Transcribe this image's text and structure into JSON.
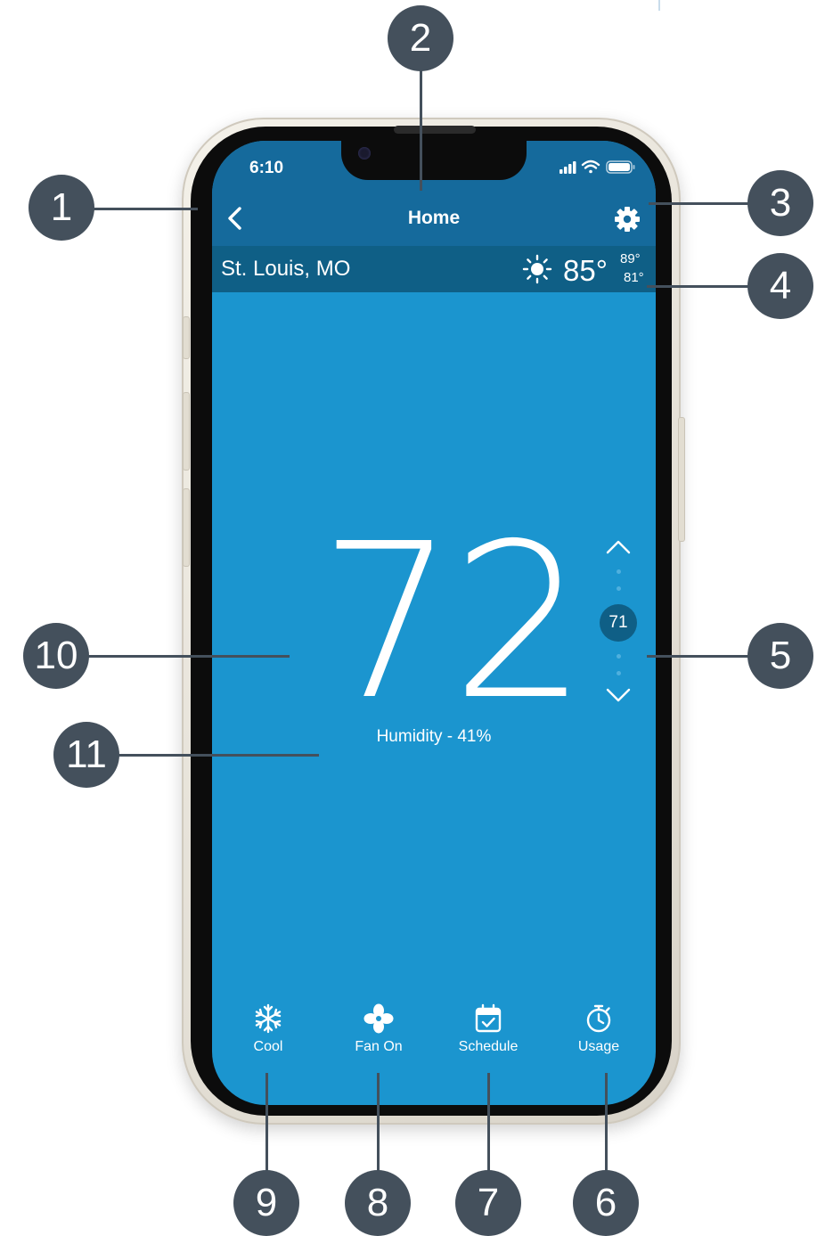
{
  "status_bar": {
    "time": "6:10"
  },
  "nav": {
    "title": "Home",
    "back_icon": "chevron-left-icon",
    "settings_icon": "gear-icon"
  },
  "weather": {
    "city": "St. Louis, MO",
    "icon": "sun-icon",
    "current": "85°",
    "high": "89°",
    "low": "81°"
  },
  "thermostat": {
    "current_temp": "72",
    "humidity": "Humidity - 41%",
    "setpoint": "71",
    "up_icon": "chevron-up-icon",
    "down_icon": "chevron-down-icon"
  },
  "bottom_nav": [
    {
      "label": "Cool",
      "icon": "snowflake-icon"
    },
    {
      "label": "Fan On",
      "icon": "fan-icon"
    },
    {
      "label": "Schedule",
      "icon": "calendar-check-icon"
    },
    {
      "label": "Usage",
      "icon": "stopwatch-icon"
    }
  ],
  "callouts": [
    "1",
    "2",
    "3",
    "4",
    "5",
    "6",
    "7",
    "8",
    "9",
    "10",
    "11"
  ],
  "colors": {
    "screen": "#1b95cf",
    "header": "#156a9c",
    "weather_bar": "#0f5f86",
    "callout": "#44505c"
  }
}
